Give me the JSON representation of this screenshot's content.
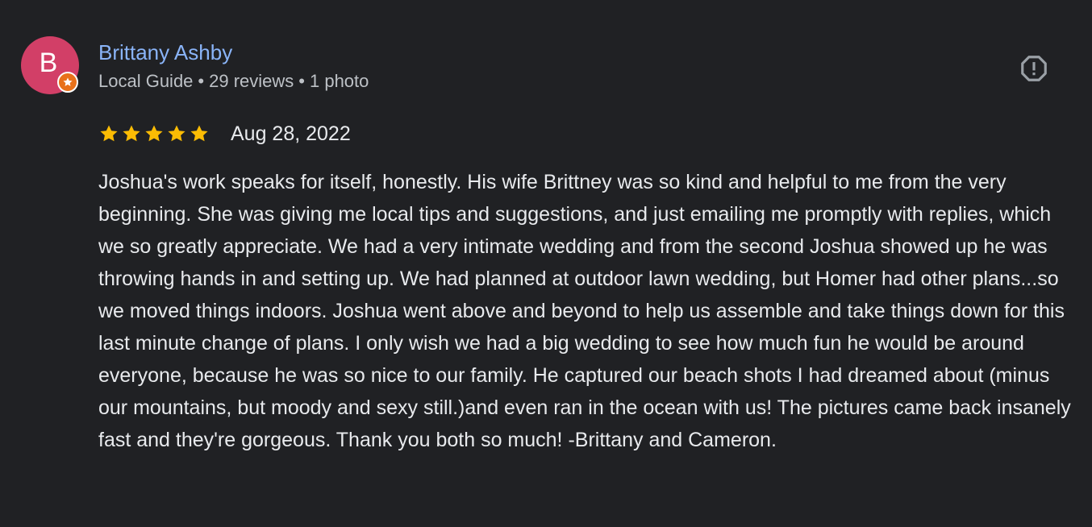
{
  "reviewer": {
    "initial": "B",
    "name": "Brittany Ashby",
    "guide_label": "Local Guide",
    "reviews": "29 reviews",
    "photos": "1 photo",
    "separator": "•",
    "avatar_color": "#d23f67",
    "badge_color": "#e8711a"
  },
  "review": {
    "rating": 5,
    "rating_max": 5,
    "star_color": "#fbbc04",
    "date": "Aug 28, 2022",
    "text": "Joshua's work speaks for itself, honestly. His wife Brittney was so kind and helpful to me from the very beginning. She was giving me local tips and suggestions, and just emailing me promptly with replies, which we so greatly appreciate. We had a very intimate wedding and from the second Joshua showed up he was throwing hands in and setting up. We had planned at outdoor lawn wedding, but Homer had other plans...so we moved things indoors. Joshua went above and beyond to help us assemble and take things down for this last minute change of plans. I only wish we had a big wedding to see how much fun he would be around everyone, because he was so nice to our family. He captured our beach shots I had dreamed about (minus our mountains, but moody and sexy still.)and even ran in the ocean with us! The pictures came back insanely fast and they're gorgeous. Thank you both so much! -Brittany and Cameron."
  },
  "icons": {
    "badge": "local-guide-star-icon",
    "report": "report-icon",
    "star": "star-icon"
  },
  "colors": {
    "background": "#202124",
    "name_link": "#8ab4f8",
    "meta_text": "#bdc1c6",
    "body_text": "#e8eaed"
  }
}
